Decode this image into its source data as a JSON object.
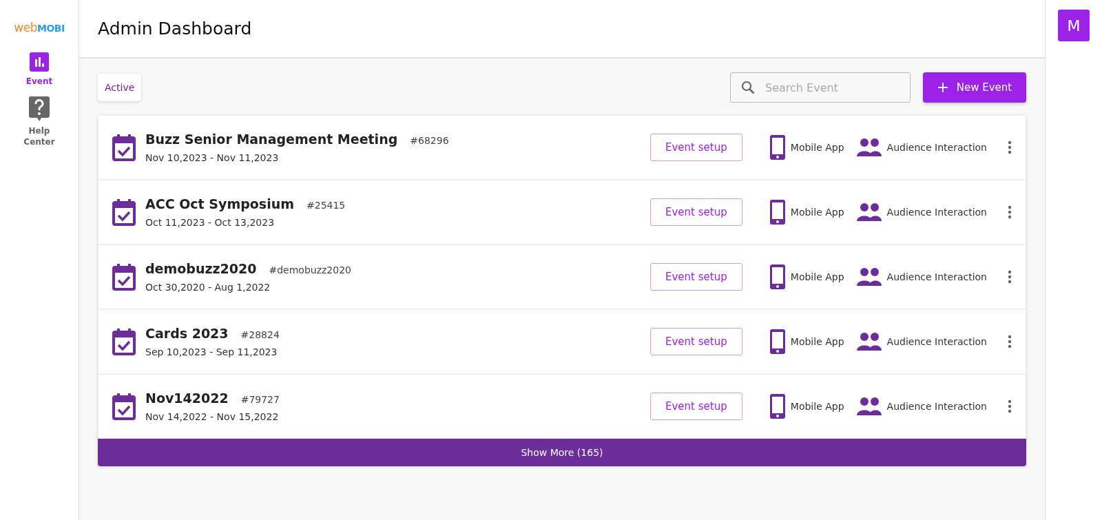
{
  "logo": {
    "first": "web",
    "second": "MOBI"
  },
  "sidebar": {
    "items": [
      {
        "label": "Event",
        "selected": true,
        "kind": "chart"
      },
      {
        "label": "Help Center",
        "selected": false,
        "kind": "help"
      }
    ]
  },
  "header": {
    "title": "Admin Dashboard"
  },
  "avatar": {
    "initial": "M"
  },
  "tabs": [
    {
      "label": "Active",
      "selected": true
    }
  ],
  "search": {
    "placeholder": "Search Event"
  },
  "new_event_button": {
    "label": "New Event"
  },
  "events": [
    {
      "name": "Buzz Senior Management Meeting",
      "code": "#68296",
      "dates": "Nov 10,2023 - Nov 11,2023",
      "setup": "Event setup",
      "mobile": "Mobile App",
      "audience": "Audience Interaction"
    },
    {
      "name": "ACC Oct Symposium",
      "code": "#25415",
      "dates": "Oct 11,2023 - Oct 13,2023",
      "setup": "Event setup",
      "mobile": "Mobile App",
      "audience": "Audience Interaction"
    },
    {
      "name": "demobuzz2020",
      "code": "#demobuzz2020",
      "dates": "Oct 30,2020 - Aug 1,2022",
      "setup": "Event setup",
      "mobile": "Mobile App",
      "audience": "Audience Interaction"
    },
    {
      "name": "Cards 2023",
      "code": "#28824",
      "dates": "Sep 10,2023 - Sep 11,2023",
      "setup": "Event setup",
      "mobile": "Mobile App",
      "audience": "Audience Interaction"
    },
    {
      "name": "Nov142022",
      "code": "#79727",
      "dates": "Nov 14,2022 - Nov 15,2022",
      "setup": "Event setup",
      "mobile": "Mobile App",
      "audience": "Audience Interaction"
    }
  ],
  "show_more": {
    "label": "Show More (165)"
  }
}
